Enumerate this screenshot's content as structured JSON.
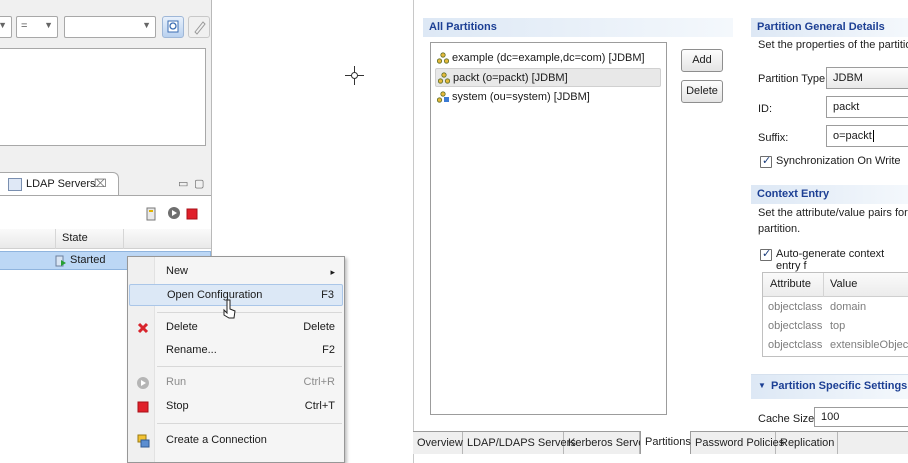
{
  "left_toolbar": {
    "combo1_value": "",
    "combo2_value": "=",
    "combo3_value": ""
  },
  "servers_view": {
    "tab_label": "LDAP Servers",
    "tab_close": "⌧",
    "header_state": "State",
    "row_state": "Started"
  },
  "context_menu": {
    "items": [
      {
        "label": "New",
        "accel": "▸"
      },
      {
        "label": "Open Configuration",
        "accel": "F3"
      },
      {
        "label": "Delete",
        "accel": "Delete"
      },
      {
        "label": "Rename...",
        "accel": "F2"
      },
      {
        "label": "Run",
        "accel": "Ctrl+R"
      },
      {
        "label": "Stop",
        "accel": "Ctrl+T"
      },
      {
        "label": "Create a Connection",
        "accel": ""
      }
    ]
  },
  "partitions": {
    "section_title": "All Partitions",
    "items": [
      "example (dc=example,dc=com) [JDBM]",
      "packt (o=packt) [JDBM]",
      "system (ou=system) [JDBM]"
    ],
    "add_label": "Add",
    "delete_label": "Delete"
  },
  "general_details": {
    "title": "Partition General Details",
    "description": "Set the properties of the partition",
    "type_label": "Partition Type:",
    "type_value": "JDBM",
    "id_label": "ID:",
    "id_value": "packt",
    "suffix_label": "Suffix:",
    "suffix_value": "o=packt",
    "sync_label": "Synchronization On Write"
  },
  "context_entry": {
    "title": "Context Entry",
    "description_line1": "Set the attribute/value pairs for th",
    "description_line2": "partition.",
    "autogen_label": "Auto-generate context entry f",
    "col_attribute": "Attribute",
    "col_value": "Value",
    "rows": [
      {
        "attr": "objectclass",
        "value": "domain"
      },
      {
        "attr": "objectclass",
        "value": "top"
      },
      {
        "attr": "objectclass",
        "value": "extensibleObject"
      }
    ]
  },
  "specific_settings": {
    "title": "Partition Specific Settings",
    "cache_label": "Cache Size:",
    "cache_value": "100"
  },
  "editor_tabs": [
    "Overview",
    "LDAP/LDAPS Servers",
    "Kerberos Server",
    "Partitions",
    "Password Policies",
    "Replication"
  ],
  "colors": {
    "section_title": "#1c3f94",
    "selection": "#bcd7f5",
    "menu_hover": "#dce8f6"
  }
}
